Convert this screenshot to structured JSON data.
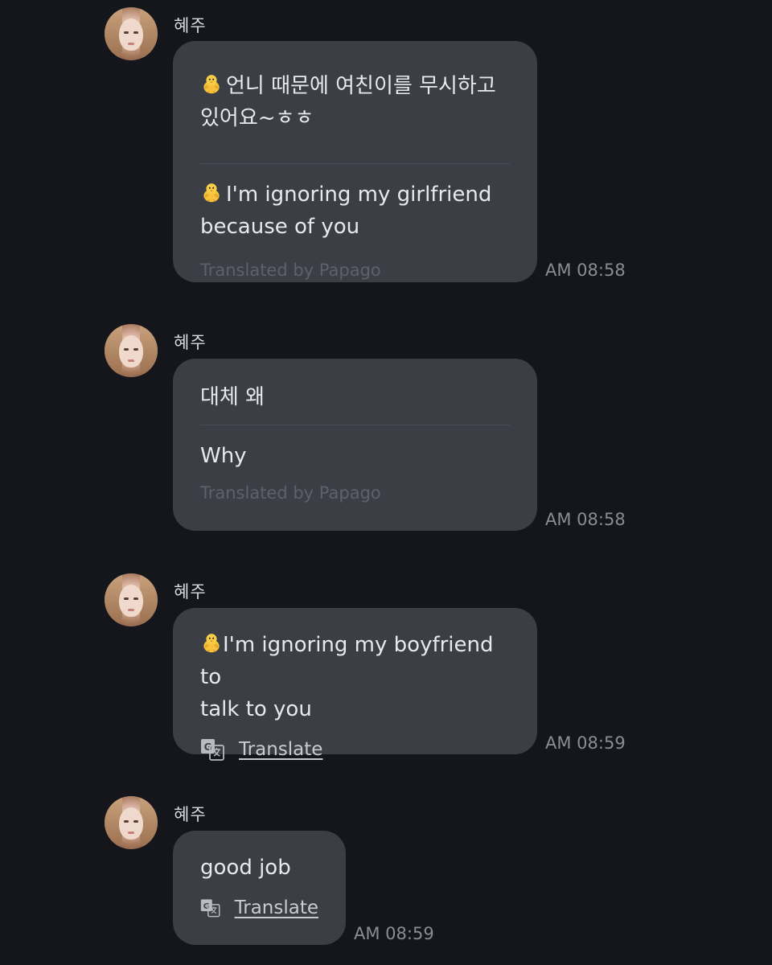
{
  "icons": {
    "chick": "baby-chick-emoji",
    "translate": "translate-icon"
  },
  "colors": {
    "background": "#14161b",
    "bubble": "#3b3e45",
    "credit": "#5e6169",
    "time": "#8a8d94"
  },
  "messages": [
    {
      "sender": "혜주",
      "original": [
        "언니 때문에 여친이를 무시하고",
        "있어요~ㅎㅎ"
      ],
      "translation": [
        "I'm ignoring my girlfriend",
        "because of you"
      ],
      "credit": "Translated by Papago",
      "time": "AM 08:58"
    },
    {
      "sender": "혜주",
      "original": [
        "대체 왜"
      ],
      "translation": [
        "Why"
      ],
      "credit": "Translated by Papago",
      "time": "AM 08:58"
    },
    {
      "sender": "혜주",
      "text": [
        "I'm ignoring my boyfriend to",
        "talk to you"
      ],
      "translate_label": "Translate",
      "time": "AM 08:59"
    },
    {
      "sender": "혜주",
      "text": [
        "good job"
      ],
      "translate_label": "Translate",
      "time": "AM 08:59"
    }
  ]
}
